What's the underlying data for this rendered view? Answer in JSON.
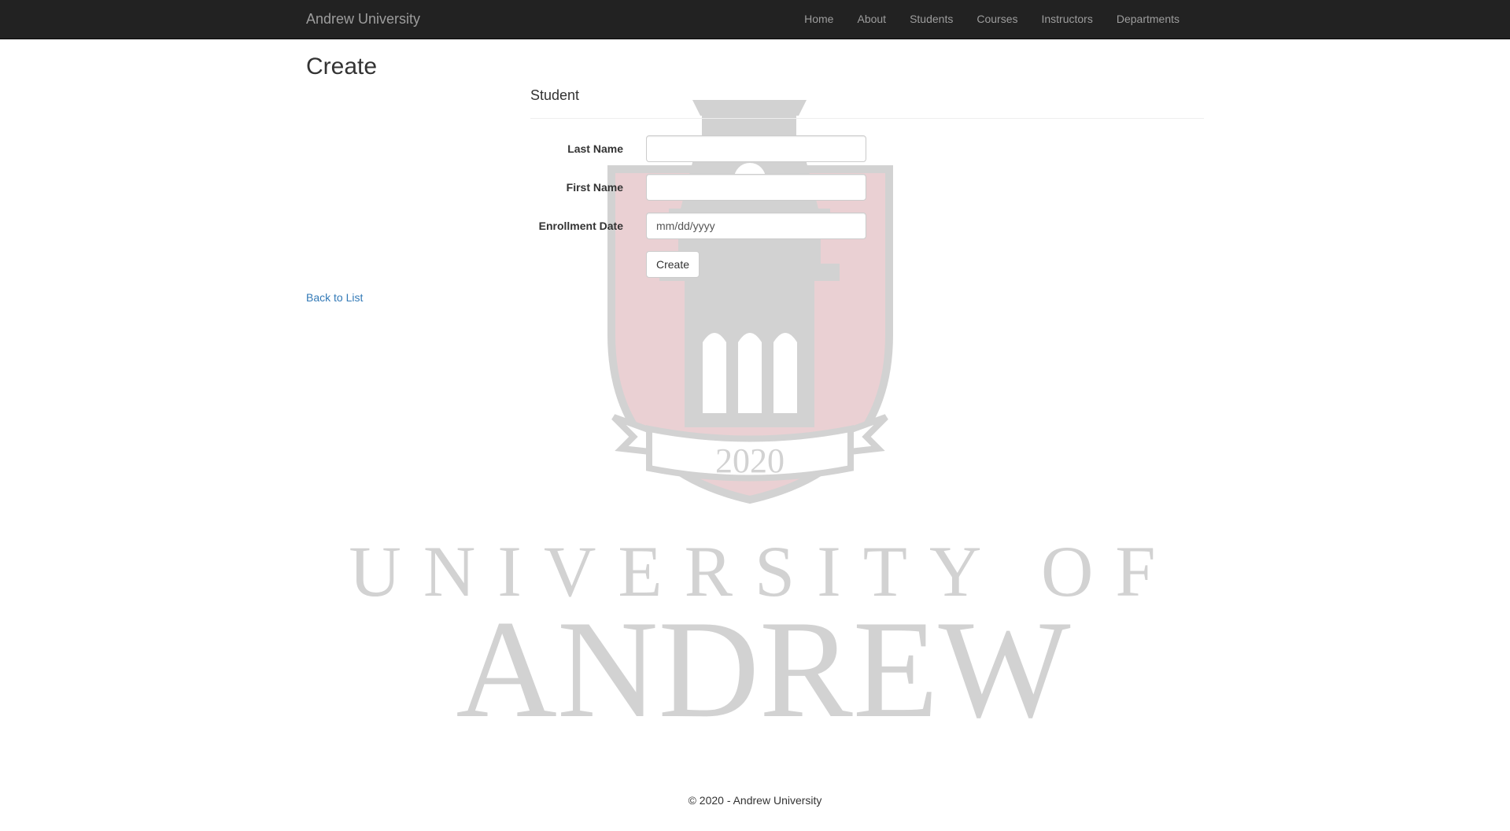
{
  "navbar": {
    "brand": "Andrew University",
    "items": [
      {
        "label": "Home"
      },
      {
        "label": "About"
      },
      {
        "label": "Students"
      },
      {
        "label": "Courses"
      },
      {
        "label": "Instructors"
      },
      {
        "label": "Departments"
      }
    ]
  },
  "page": {
    "title": "Create"
  },
  "form": {
    "section_title": "Student",
    "fields": {
      "last_name": {
        "label": "Last Name",
        "value": "",
        "placeholder": ""
      },
      "first_name": {
        "label": "First Name",
        "value": "",
        "placeholder": ""
      },
      "enrollment_date": {
        "label": "Enrollment Date",
        "value": "",
        "placeholder": "mm/dd/yyyy"
      }
    },
    "submit_label": "Create"
  },
  "back_link": "Back to List",
  "watermark": {
    "year": "2020",
    "line1": "UNIVERSITY OF",
    "line2": "ANDREW",
    "colors": {
      "gray": "#d2d2d2",
      "red": "#ead0d3"
    }
  },
  "footer": {
    "text": "© 2020 - Andrew University"
  },
  "colors": {
    "navbar_bg": "#222222",
    "nav_text": "#9d9d9d",
    "link": "#337ab7"
  }
}
